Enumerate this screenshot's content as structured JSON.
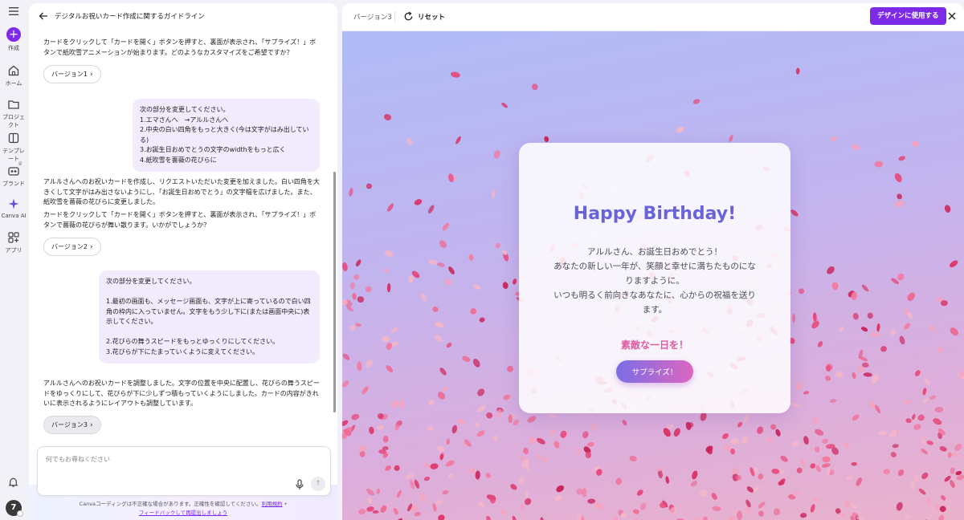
{
  "rail": {
    "items": [
      {
        "label": "作成"
      },
      {
        "label": "ホーム"
      },
      {
        "label": "プロジェクト"
      },
      {
        "label": "テンプレート"
      },
      {
        "label": "ブランド"
      },
      {
        "label": "Canva AI"
      },
      {
        "label": "アプリ"
      }
    ],
    "avatar_initial": "7"
  },
  "chat": {
    "title": "デジタルお祝いカード作成に関するガイドライン",
    "messages": [
      {
        "role": "ai",
        "text": "カードをクリックして「カードを開く」ボタンを押すと、裏面が表示され、「サプライズ！」ボタンで紙吹雪アニメーションが始まります。どのようなカスタマイズをご希望ですか？"
      },
      {
        "role": "version",
        "label": "バージョン1"
      },
      {
        "role": "user",
        "lines": [
          "次の部分を変更してください。",
          "1.エマさんへ　→アルルさんへ",
          "2.中央の白い四角をもっと大きく(今は文字がはみ出している)",
          "3.お誕生日おめでとうの文字のwidthをもっと広く",
          "4.紙吹雪を薔薇の花びらに"
        ]
      },
      {
        "role": "ai",
        "text": "アルルさんへのお祝いカードを作成し、リクエストいただいた変更を加えました。白い四角を大きくして文字がはみ出さないようにし、「お誕生日おめでとう」の文字幅を広げました。また、紙吹雪を薔薇の花びらに変更しました。"
      },
      {
        "role": "ai",
        "text": "カードをクリックして「カードを開く」ボタンを押すと、裏面が表示され、「サプライズ！」ボタンで薔薇の花びらが舞い散ります。いかがでしょうか？"
      },
      {
        "role": "version",
        "label": "バージョン2"
      },
      {
        "role": "user",
        "lines": [
          "次の部分を変更してください。",
          "",
          "1.最初の画面も、メッセージ画面も、文字が上に寄っているので白い四角の枠内に入っていません。文字をもう少し下に(または画面中央に)表示してください。",
          "",
          "2.花びらの舞うスピードをもっとゆっくりにしてください。",
          "3.花びらが下にたまっていくように変えてください。"
        ]
      },
      {
        "role": "ai",
        "text": "アルルさんへのお祝いカードを調整しました。文字の位置を中央に配置し、花びらの舞うスピードをゆっくりにして、花びらが下に少しずつ積もっていくようにしました。カードの内容がきれいに表示されるようにレイアウトも調整しています。"
      },
      {
        "role": "version",
        "label": "バージョン3"
      }
    ],
    "input_placeholder": "何でもお尋ねください",
    "footer_text": "Canvaコーディングは不正確な場合があります。正確性を確認してください。",
    "footer_link_terms": "利用規約",
    "footer_link_feedback": "フィードバックして再提出しましょう"
  },
  "topbar": {
    "version_label": "バージョン3",
    "reset_label": "リセット",
    "use_button": "デザインに使用する"
  },
  "card": {
    "title": "Happy Birthday!",
    "message_lines": [
      "アルルさん、お誕生日おめでとう！",
      "あなたの新しい一年が、笑顔と幸せに満ちたものになりますように。",
      "いつも明るく前向きなあなたに、心からの祝福を送ります。"
    ],
    "subtitle": "素敵な一日を！",
    "button": "サプライズ！"
  },
  "colors": {
    "accent": "#7d2ae8",
    "card_title": "#6a63d8",
    "card_subtitle": "#e05aa2",
    "user_bubble": "#f1ebfd"
  }
}
